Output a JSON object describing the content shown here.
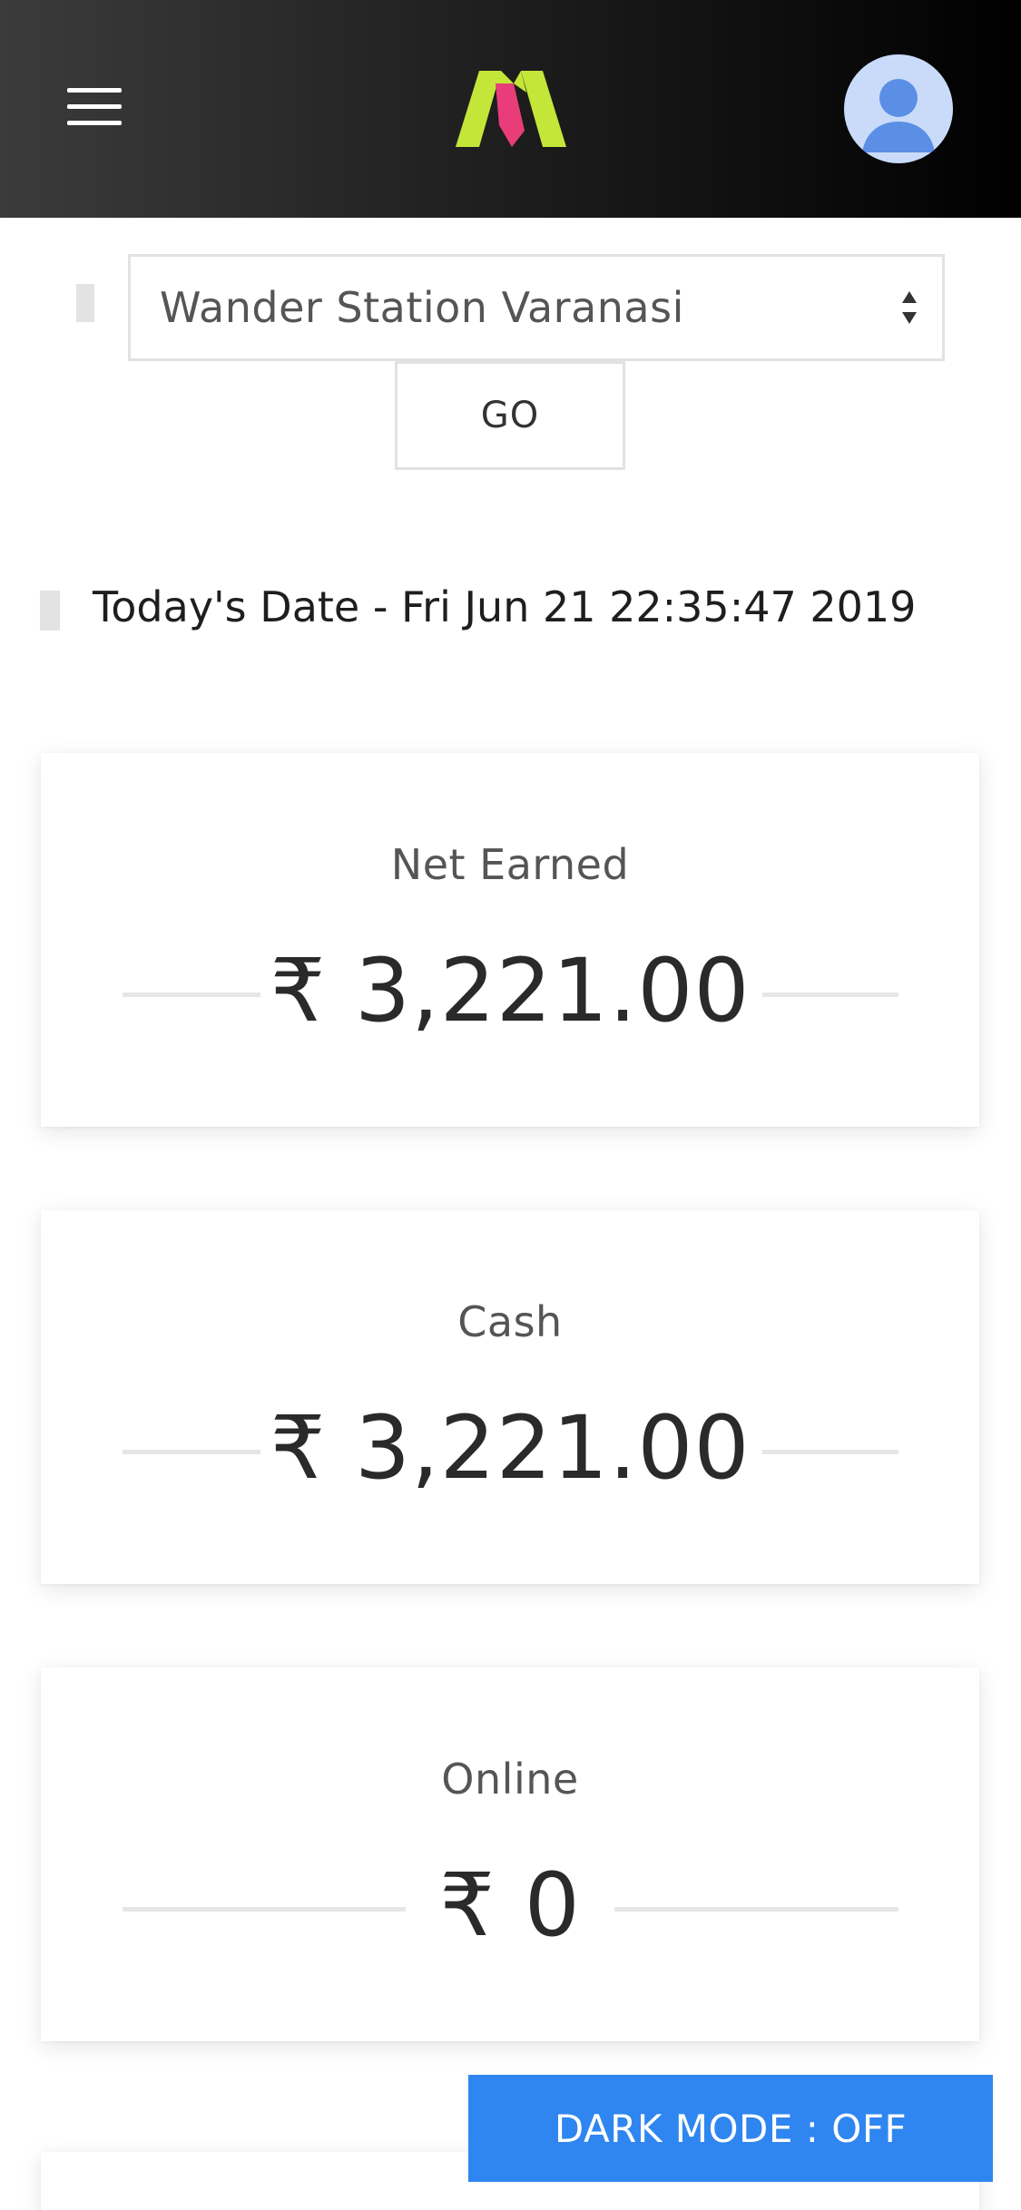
{
  "header": {
    "menu_icon": "hamburger-menu-icon",
    "logo_icon": "app-logo",
    "avatar_icon": "user-avatar-icon",
    "colors": {
      "logo_green": "#c4e639",
      "logo_pink": "#e83d78",
      "avatar_bg": "#c9dbf9",
      "avatar_fg": "#5b8fe6"
    }
  },
  "property_select": {
    "value": "Wander Station Varanasi",
    "arrow_icon": "select-arrows-icon"
  },
  "go_button": {
    "label": "GO"
  },
  "today": {
    "label": "Today's Date - Fri Jun 21 22:35:47 2019"
  },
  "cards": [
    {
      "label": "Net Earned",
      "value": "₹ 3,221.00"
    },
    {
      "label": "Cash",
      "value": "₹ 3,221.00"
    },
    {
      "label": "Online",
      "value": "₹ 0"
    }
  ],
  "dark_mode": {
    "label": "DARK MODE : OFF",
    "color": "#2f86f0"
  }
}
